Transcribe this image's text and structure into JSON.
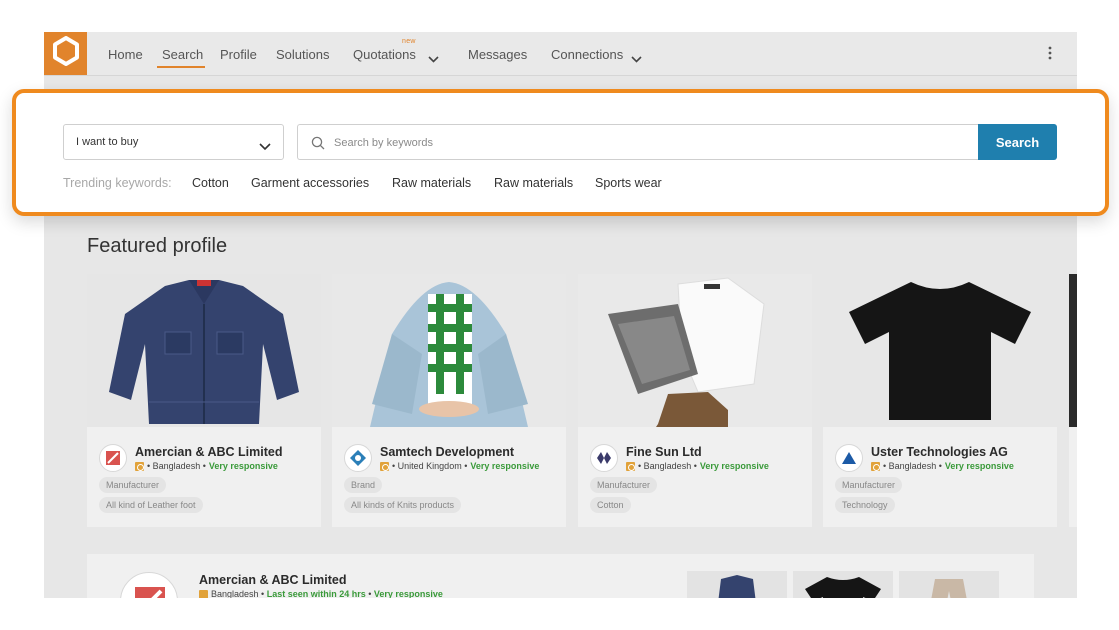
{
  "nav": {
    "items": [
      {
        "label": "Home"
      },
      {
        "label": "Search"
      },
      {
        "label": "Profile"
      },
      {
        "label": "Solutions"
      },
      {
        "label": "Quotations"
      },
      {
        "label": "Messages"
      },
      {
        "label": "Connections"
      }
    ],
    "active": "Search",
    "quotations_badge": "new",
    "logo_icon": "gear-hexagon-icon",
    "menu_icon": "kebab-menu-icon",
    "accent": "#e1842c"
  },
  "search": {
    "intent_value": "I want to buy",
    "placeholder": "Search by keywords",
    "button_label": "Search",
    "button_color": "#1f7fae",
    "trending_label": "Trending keywords:",
    "trending": [
      "Cotton",
      "Garment accessories",
      "Raw materials",
      "Raw materials",
      "Sports wear"
    ],
    "highlight_color": "#ef8a1e"
  },
  "featured": {
    "title": "Featured profile",
    "cards": [
      {
        "name": "Amercian & ABC Limited",
        "country": "Bangladesh",
        "responsiveness": "Very responsive",
        "type": "Manufacturer",
        "tag": "All kind of Leather foot",
        "image": "denim-jacket"
      },
      {
        "name": "Samtech Development",
        "country": "United Kingdom",
        "responsiveness": "Very responsive",
        "type": "Brand",
        "tag": "All kinds of Knits products",
        "image": "person-in-jacket"
      },
      {
        "name": "Fine Sun Ltd",
        "country": "Bangladesh",
        "responsiveness": "Very responsive",
        "type": "Manufacturer",
        "tag": "Cotton",
        "image": "folded-clothes"
      },
      {
        "name": "Uster Technologies AG",
        "country": "Bangladesh",
        "responsiveness": "Very responsive",
        "type": "Manufacturer",
        "tag": "Technology",
        "image": "black-tshirt"
      }
    ]
  },
  "listing": {
    "name": "Amercian & ABC Limited",
    "country": "Bangladesh",
    "last_seen": "Last seen within 24 hrs",
    "responsiveness": "Very responsive"
  }
}
